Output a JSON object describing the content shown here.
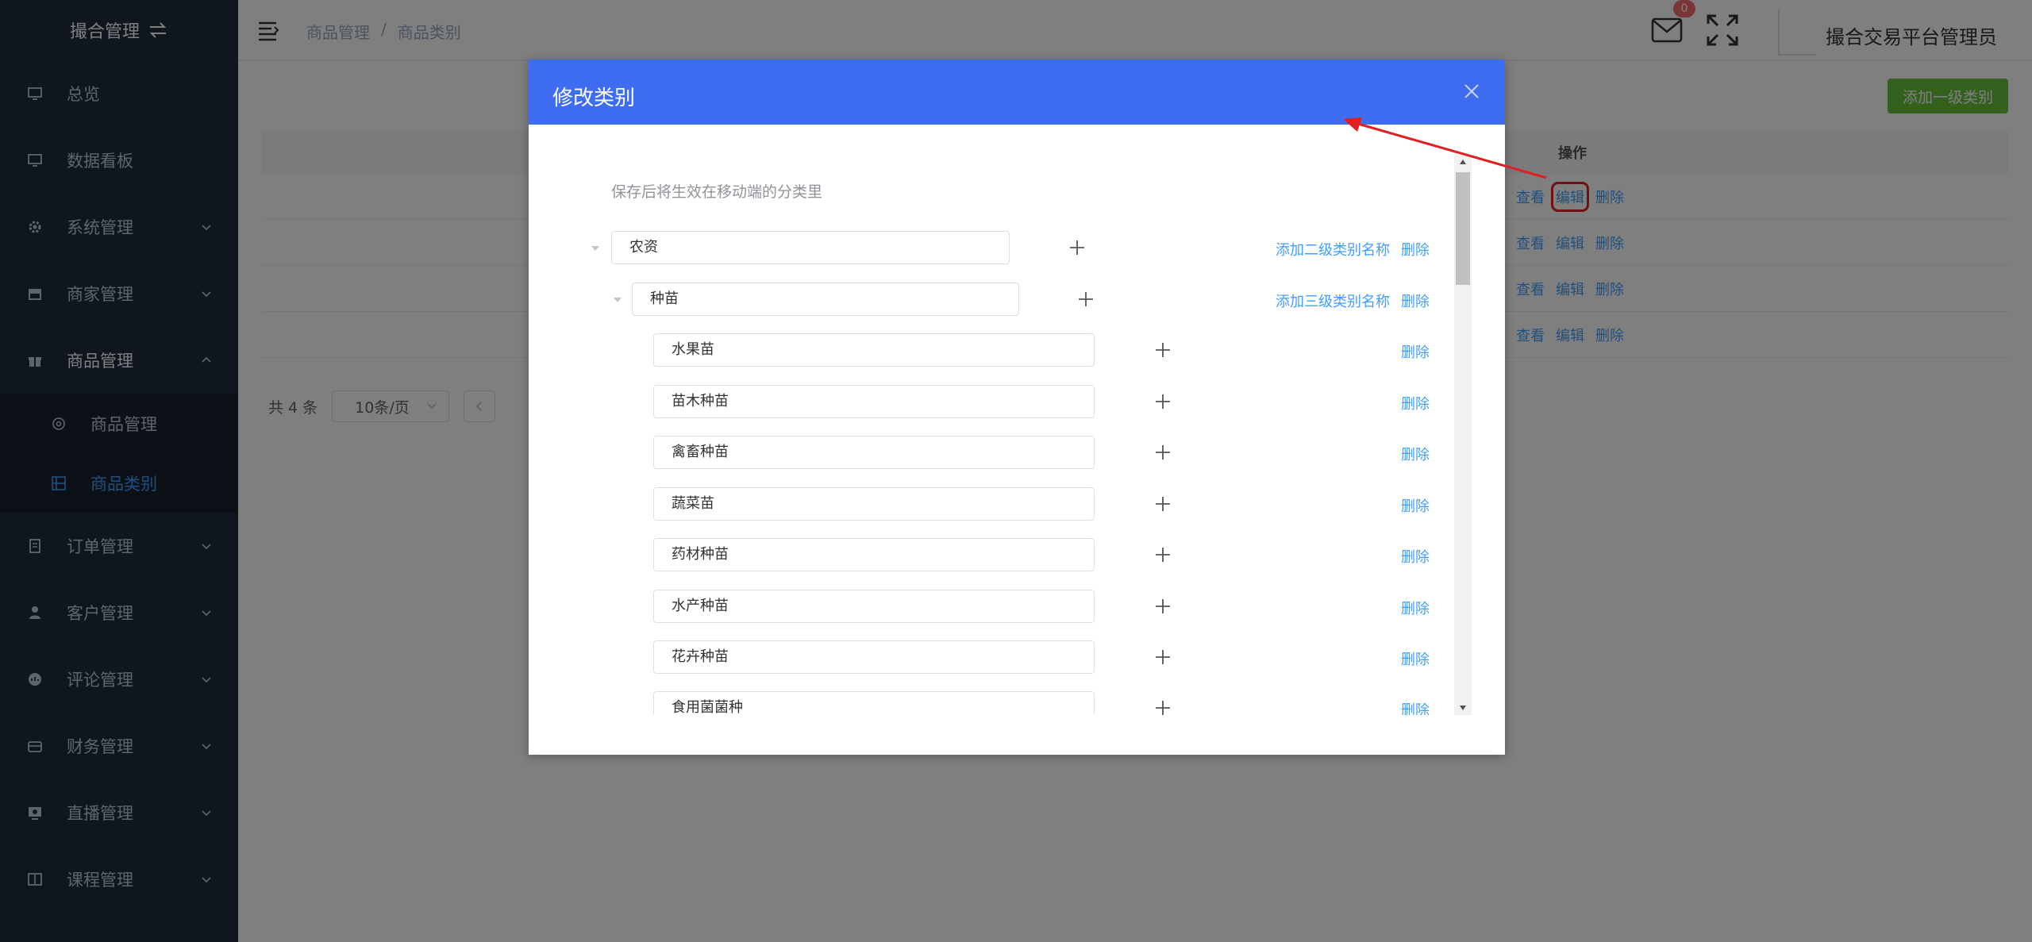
{
  "sidebar": {
    "brand": "撮合管理",
    "items": [
      {
        "label": "总览",
        "icon": "monitor-icon",
        "chevron": false
      },
      {
        "label": "数据看板",
        "icon": "monitor-icon",
        "chevron": false
      },
      {
        "label": "系统管理",
        "icon": "gear-icon",
        "chevron": true
      },
      {
        "label": "商家管理",
        "icon": "store-icon",
        "chevron": true
      },
      {
        "label": "商品管理",
        "icon": "gift-icon",
        "chevron": true,
        "open": true
      },
      {
        "label": "订单管理",
        "icon": "document-icon",
        "chevron": true
      },
      {
        "label": "客户管理",
        "icon": "user-icon",
        "chevron": true
      },
      {
        "label": "评论管理",
        "icon": "comment-icon",
        "chevron": true
      },
      {
        "label": "财务管理",
        "icon": "wallet-icon",
        "chevron": true
      },
      {
        "label": "直播管理",
        "icon": "live-icon",
        "chevron": true
      },
      {
        "label": "课程管理",
        "icon": "book-icon",
        "chevron": true
      }
    ],
    "sub_items": [
      {
        "label": "商品管理",
        "icon": "settings-icon",
        "active": false
      },
      {
        "label": "商品类别",
        "icon": "grid-icon",
        "active": true
      }
    ]
  },
  "header": {
    "breadcrumb": [
      "商品管理",
      "/",
      "商品类别"
    ],
    "mail_badge": "0",
    "username": "撮合交易平台管理员"
  },
  "main": {
    "add_button": "添加一级类别",
    "table_header_op": "操作",
    "row_ops": [
      "查看",
      "编辑",
      "删除"
    ],
    "row_count": 4,
    "pager_total": "共 4 条",
    "pager_size": "10条/页"
  },
  "dialog": {
    "title": "修改类别",
    "hint": "保存后将生效在移动端的分类里",
    "level1": {
      "value": "农资",
      "add_link": "添加二级类别名称",
      "delete": "删除"
    },
    "level2": {
      "value": "种苗",
      "add_link": "添加三级类别名称",
      "delete": "删除"
    },
    "level3": [
      {
        "value": "水果苗",
        "delete": "删除"
      },
      {
        "value": "苗木种苗",
        "delete": "删除"
      },
      {
        "value": "禽畜种苗",
        "delete": "删除"
      },
      {
        "value": "蔬菜苗",
        "delete": "删除"
      },
      {
        "value": "药材种苗",
        "delete": "删除"
      },
      {
        "value": "水产种苗",
        "delete": "删除"
      },
      {
        "value": "花卉种苗",
        "delete": "删除"
      },
      {
        "value": "食用菌菌种",
        "delete": "删除"
      }
    ]
  },
  "colors": {
    "sidebar_bg": "#1f2d3d",
    "dialog_header": "#3f6df2",
    "link": "#409eff",
    "add_button": "#67c23a",
    "annotation": "#e02020"
  }
}
